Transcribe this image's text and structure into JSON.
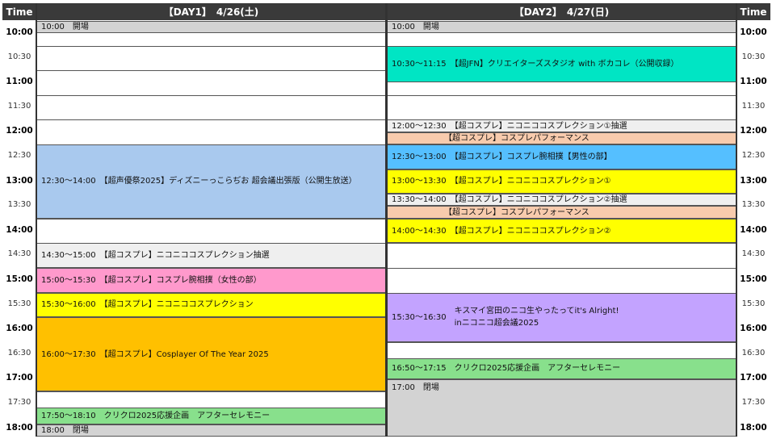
{
  "header": {
    "time_left": "Time",
    "day1": "【DAY1】　4/26(土)",
    "day2": "【DAY2】　4/27(日)",
    "time_right": "Time"
  },
  "time_labels": [
    "10:00",
    "10:30",
    "11:00",
    "11:30",
    "12:00",
    "12:30",
    "13:00",
    "13:30",
    "14:00",
    "14:30",
    "15:00",
    "15:30",
    "16:00",
    "16:30",
    "17:00",
    "17:30",
    "18:00"
  ],
  "colors": {
    "gray": "#d3d3d3",
    "light_gray": "#efefef",
    "blue": "#a9c9ee",
    "pink": "#ff99cc",
    "yellow": "#ffff00",
    "orange": "#ffc000",
    "green": "#88e08c",
    "teal": "#00e5c4",
    "peach": "#f8cbad",
    "sky": "#55bfff",
    "lavender": "#c3a3ff"
  },
  "day1_events": [
    {
      "start": "10:00",
      "end": "10:15",
      "color": "gray",
      "text": "10:00　開場"
    },
    {
      "start": "12:30",
      "end": "14:00",
      "color": "blue",
      "text": "12:30～14:00　【超声優祭2025】ディズニーっこらぢお 超会議出張版（公開生放送）"
    },
    {
      "start": "14:30",
      "end": "15:00",
      "color": "light_gray",
      "text": "14:30～15:00　【超コスプレ】ニコニココスプレクション抽選"
    },
    {
      "start": "15:00",
      "end": "15:30",
      "color": "pink",
      "text": "15:00～15:30　【超コスプレ】コスプレ腕相撲（女性の部）"
    },
    {
      "start": "15:30",
      "end": "16:00",
      "color": "yellow",
      "text": "15:30～16:00　【超コスプレ】ニコニココスプレクション"
    },
    {
      "start": "16:00",
      "end": "17:30",
      "color": "orange",
      "text": "16:00～17:30　【超コスプレ】Cosplayer Of The Year 2025"
    },
    {
      "start": "17:50",
      "end": "18:10",
      "color": "green",
      "text": "17:50～18:10　クリクロ2025応援企画　アフターセレモニー"
    },
    {
      "start": "18:10",
      "end": "18:25",
      "color": "gray",
      "text": "18:00　閉場"
    }
  ],
  "day2_events": [
    {
      "start": "10:00",
      "end": "10:15",
      "color": "gray",
      "text": "10:00　開場"
    },
    {
      "start": "10:30",
      "end": "11:15",
      "color": "teal",
      "text": "10:30～11:15　【超JFN】クリエイターズスタジオ with ボカコレ（公開収録）"
    },
    {
      "start": "12:00",
      "end": "12:15",
      "color": "light_gray",
      "text": "12:00～12:30　【超コスプレ】ニコニココスプレクション①抽選"
    },
    {
      "start": "12:15",
      "end": "12:30",
      "color": "peach",
      "text": "　　　　　　　【超コスプレ】コスプレパフォーマンス"
    },
    {
      "start": "12:30",
      "end": "13:00",
      "color": "sky",
      "text": "12:30～13:00　【超コスプレ】コスプレ腕相撲【男性の部】"
    },
    {
      "start": "13:00",
      "end": "13:30",
      "color": "yellow",
      "text": "13:00～13:30　【超コスプレ】ニコニココスプレクション①"
    },
    {
      "start": "13:30",
      "end": "13:45",
      "color": "light_gray",
      "text": "13:30～14:00　【超コスプレ】ニコニココスプレクション②抽選"
    },
    {
      "start": "13:45",
      "end": "14:00",
      "color": "peach",
      "text": "　　　　　　　【超コスプレ】コスプレパフォーマンス"
    },
    {
      "start": "14:00",
      "end": "14:30",
      "color": "yellow",
      "text": "14:00～14:30　【超コスプレ】ニコニココスプレクション②"
    },
    {
      "start": "15:30",
      "end": "16:30",
      "color": "lavender",
      "text": "15:30～16:30",
      "text_line1": "キスマイ宮田のニコ生やったってit's Alright!",
      "text_line2": "inニコニコ超会議2025"
    },
    {
      "start": "16:50",
      "end": "17:15",
      "color": "green",
      "text": "16:50～17:15　クリクロ2025応援企画　アフターセレモニー"
    },
    {
      "start": "17:15",
      "end": "18:25",
      "color": "gray",
      "text": "17:00　閉場"
    }
  ]
}
